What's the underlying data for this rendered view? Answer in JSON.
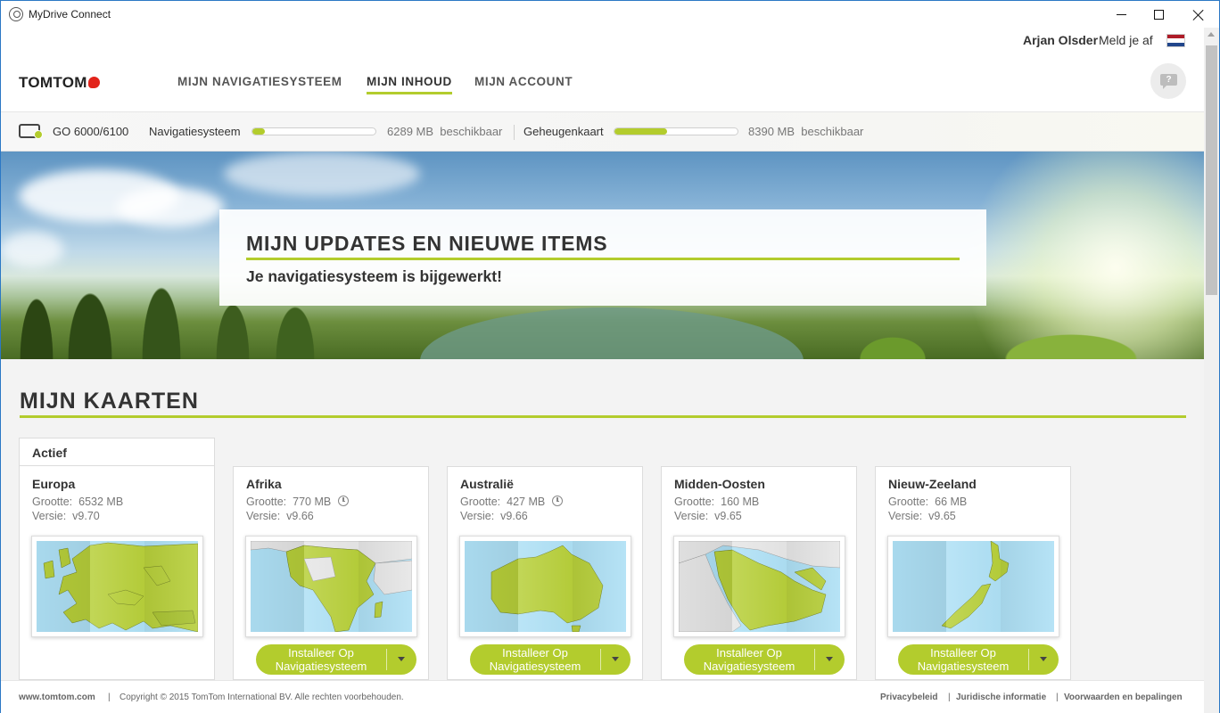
{
  "window": {
    "title": "MyDrive Connect"
  },
  "user": {
    "name": "Arjan Olsder",
    "logout": "Meld je af",
    "language_flag": "flag-nl-icon"
  },
  "nav": {
    "logo": "TOMTOM",
    "items": [
      {
        "label": "MIJN NAVIGATIESYSTEEM",
        "active": false
      },
      {
        "label": "MIJN INHOUD",
        "active": true
      },
      {
        "label": "MIJN ACCOUNT",
        "active": false
      }
    ],
    "chat_glyph": "?"
  },
  "device": {
    "name": "GO 6000/6100",
    "storage": [
      {
        "label": "Navigatiesysteem",
        "free": "6289 MB",
        "free_suffix": "beschikbaar",
        "used_fraction": 0.1
      },
      {
        "label": "Geheugenkaart",
        "free": "8390 MB",
        "free_suffix": "beschikbaar",
        "used_fraction": 0.43
      }
    ]
  },
  "hero": {
    "title": "MIJN UPDATES EN NIEUWE ITEMS",
    "subtitle": "Je navigatiesysteem is bijgewerkt!"
  },
  "maps": {
    "title": "MIJN KAARTEN",
    "active_label": "Actief",
    "size_label": "Grootte:",
    "version_label": "Versie:",
    "install_label_1": "Installeer Op",
    "install_label_2": "Navigatiesysteem",
    "items": [
      {
        "name": "Europa",
        "size": "6532 MB",
        "version": "v9.70",
        "active": true
      },
      {
        "name": "Afrika",
        "size": "770 MB",
        "version": "v9.66",
        "pending": true
      },
      {
        "name": "Australië",
        "size": "427 MB",
        "version": "v9.66",
        "pending": true
      },
      {
        "name": "Midden-Oosten",
        "size": "160 MB",
        "version": "v9.65"
      },
      {
        "name": "Nieuw-Zeeland",
        "size": "66 MB",
        "version": "v9.65"
      }
    ]
  },
  "footer": {
    "site": "www.tomtom.com",
    "copyright": "Copyright © 2015 TomTom International BV. Alle rechten voorbehouden.",
    "links": [
      "Privacybeleid",
      "Juridische informatie",
      "Voorwaarden en bepalingen"
    ]
  },
  "colors": {
    "accent": "#b3cc2d",
    "window_border": "#2b78c5",
    "brand_red": "#e2231a"
  }
}
